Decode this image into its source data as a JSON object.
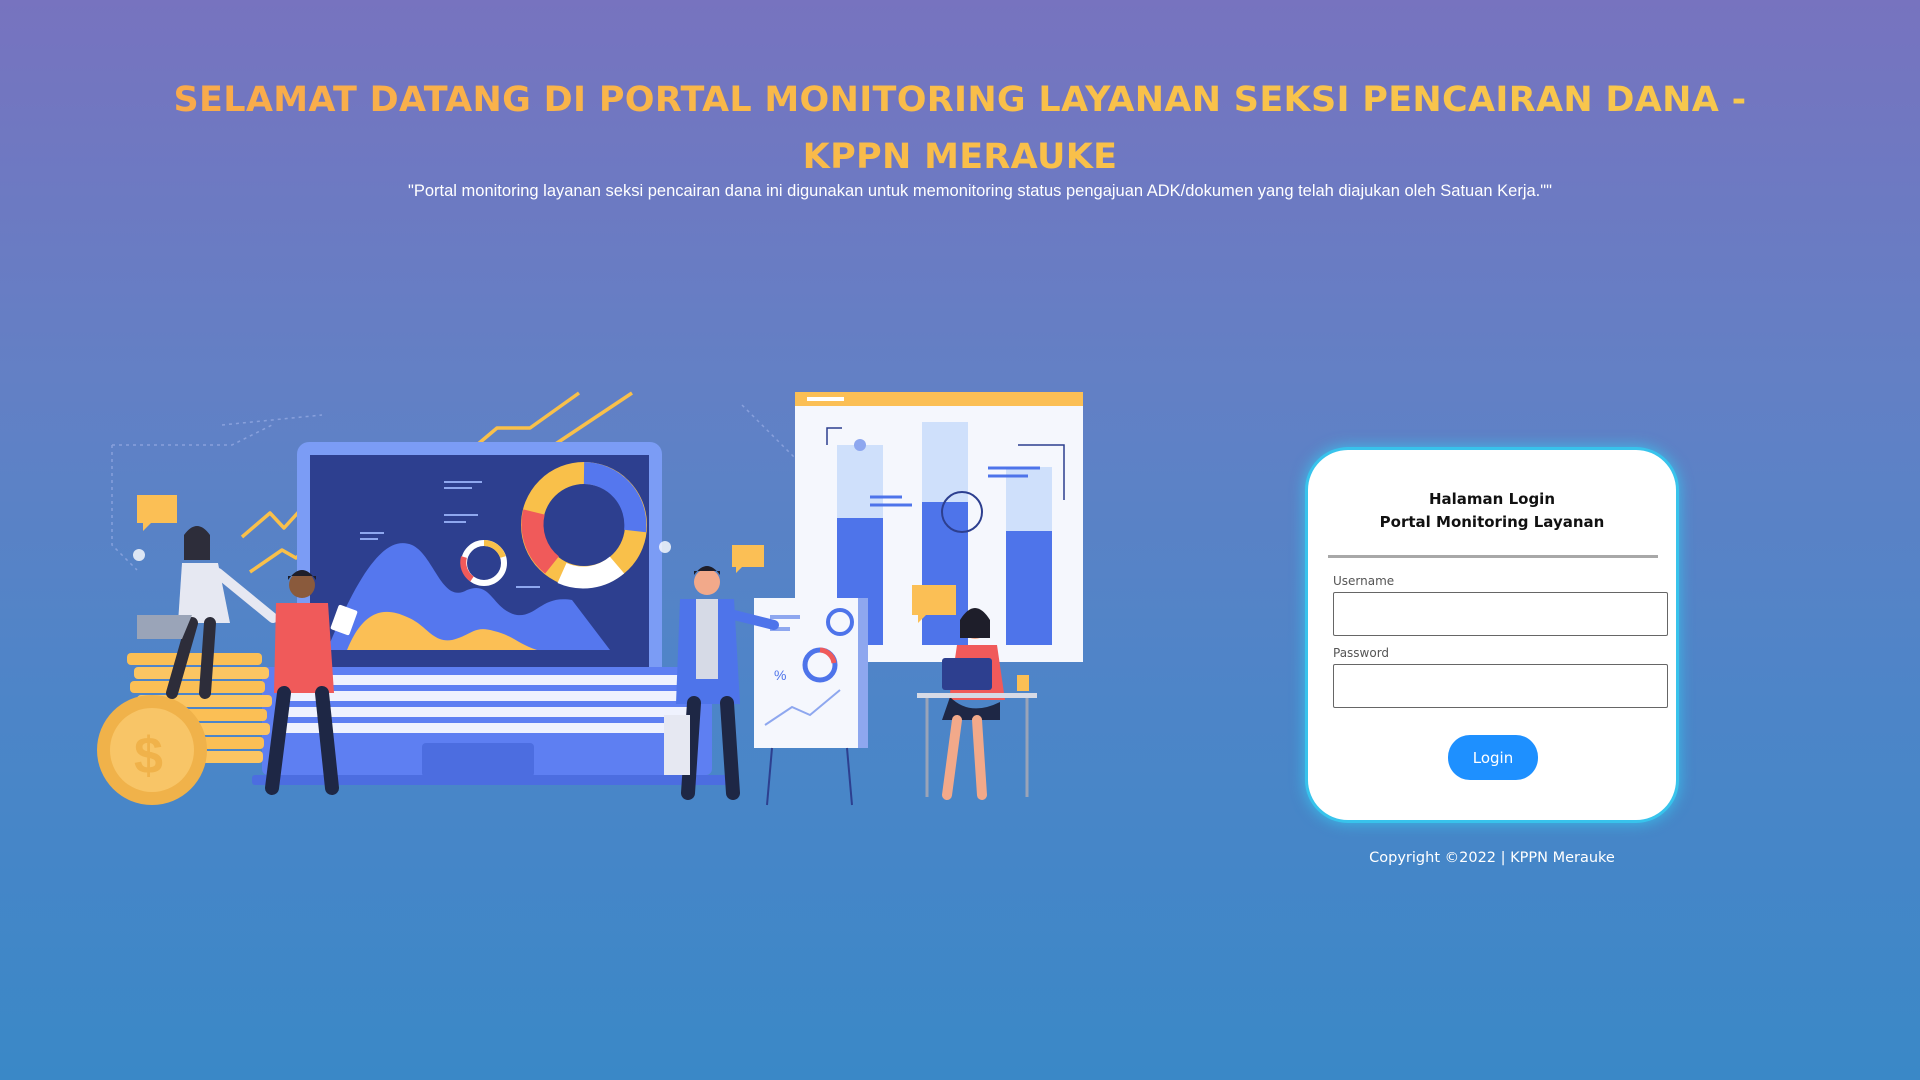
{
  "header": {
    "title": "SELAMAT DATANG DI PORTAL MONITORING LAYANAN SEKSI PENCAIRAN DANA - KPPN MERAUKE",
    "subtitle": "\"Portal monitoring layanan seksi pencairan dana ini digunakan untuk memonitoring status pengajuan ADK/dokumen yang telah diajukan oleh Satuan Kerja.\"\""
  },
  "illustration": {
    "icon": "business-analytics-illustration",
    "board_percent_symbol": "%",
    "coin_symbol": "$"
  },
  "login": {
    "heading_line1": "Halaman Login",
    "heading_line2": "Portal Monitoring Layanan",
    "username_label": "Username",
    "username_value": "",
    "password_label": "Password",
    "password_value": "",
    "button_label": "Login"
  },
  "footer": {
    "copyright": "Copyright ©2022 | KPPN Merauke"
  },
  "colors": {
    "title_gradient_start": "#f9a94b",
    "title_gradient_end": "#f7c84e",
    "button": "#1e90ff",
    "card_glow": "#38c3ec"
  }
}
